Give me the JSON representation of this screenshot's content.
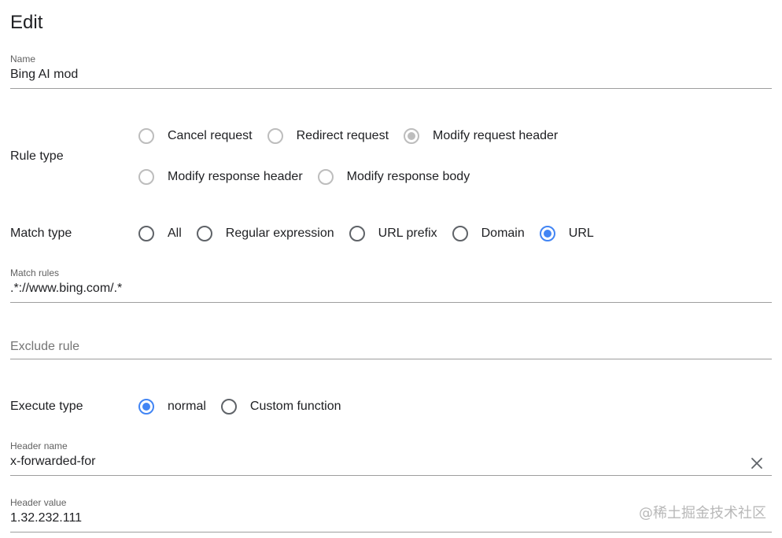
{
  "page": {
    "title": "Edit"
  },
  "name_field": {
    "label": "Name",
    "value": "Bing AI mod"
  },
  "rule_type": {
    "label": "Rule type",
    "options": [
      {
        "label": "Cancel request",
        "checked": false
      },
      {
        "label": "Redirect request",
        "checked": false
      },
      {
        "label": "Modify request header",
        "checked": true
      },
      {
        "label": "Modify response header",
        "checked": false
      },
      {
        "label": "Modify response body",
        "checked": false
      }
    ]
  },
  "match_type": {
    "label": "Match type",
    "options": [
      {
        "label": "All",
        "checked": false
      },
      {
        "label": "Regular expression",
        "checked": false
      },
      {
        "label": "URL prefix",
        "checked": false
      },
      {
        "label": "Domain",
        "checked": false
      },
      {
        "label": "URL",
        "checked": true
      }
    ]
  },
  "match_rules": {
    "label": "Match rules",
    "value": ".*://www.bing.com/.*"
  },
  "exclude_rule": {
    "placeholder": "Exclude rule",
    "value": ""
  },
  "execute_type": {
    "label": "Execute type",
    "options": [
      {
        "label": "normal",
        "checked": true
      },
      {
        "label": "Custom function",
        "checked": false
      }
    ]
  },
  "header_name": {
    "label": "Header name",
    "value": "x-forwarded-for",
    "clear_icon": "close-icon"
  },
  "header_value": {
    "label": "Header value",
    "value": "1.32.232.111"
  },
  "watermark": {
    "text": "@稀土掘金技术社区"
  },
  "colors": {
    "accent": "#4285f4",
    "disabled": "#bdbdbd",
    "underline": "#9e9e9e"
  }
}
